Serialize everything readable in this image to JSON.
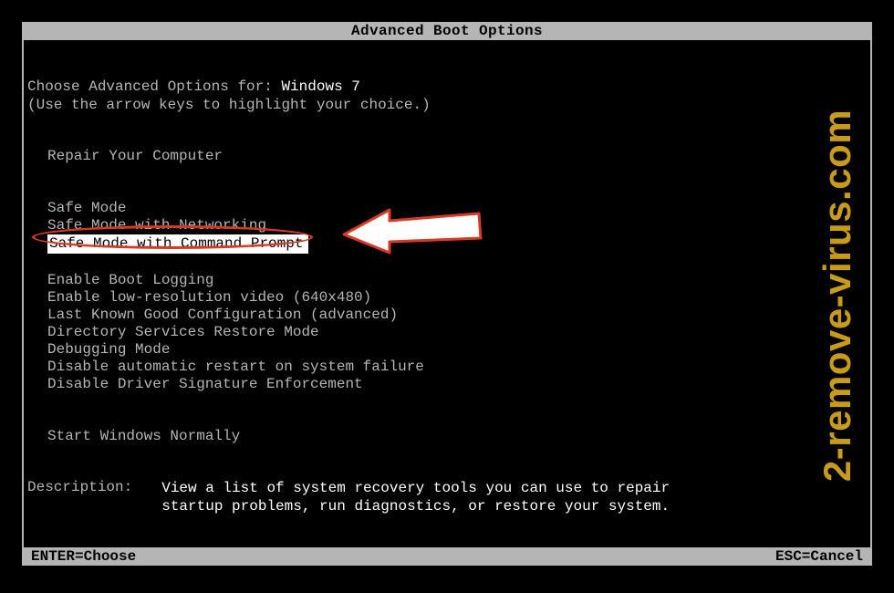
{
  "title": "Advanced Boot Options",
  "prompt_prefix": "Choose Advanced Options for: ",
  "os_name": "Windows 7",
  "instruction": "(Use the arrow keys to highlight your choice.)",
  "group0": {
    "item0": "Repair Your Computer"
  },
  "group1": {
    "item0": "Safe Mode",
    "item1": "Safe Mode with Networking",
    "item2": "Safe Mode with Command Prompt"
  },
  "group2": {
    "item0": "Enable Boot Logging",
    "item1": "Enable low-resolution video (640x480)",
    "item2": "Last Known Good Configuration (advanced)",
    "item3": "Directory Services Restore Mode",
    "item4": "Debugging Mode",
    "item5": "Disable automatic restart on system failure",
    "item6": "Disable Driver Signature Enforcement"
  },
  "group3": {
    "item0": "Start Windows Normally"
  },
  "description_label": "Description:",
  "description_text": "View a list of system recovery tools you can use to repair startup problems, run diagnostics, or restore your system.",
  "footer": {
    "enter": "ENTER=Choose",
    "esc": "ESC=Cancel"
  },
  "watermark": "2-remove-virus.com",
  "colors": {
    "highlight_ring": "#d63a22",
    "watermark": "#c99b1a"
  }
}
